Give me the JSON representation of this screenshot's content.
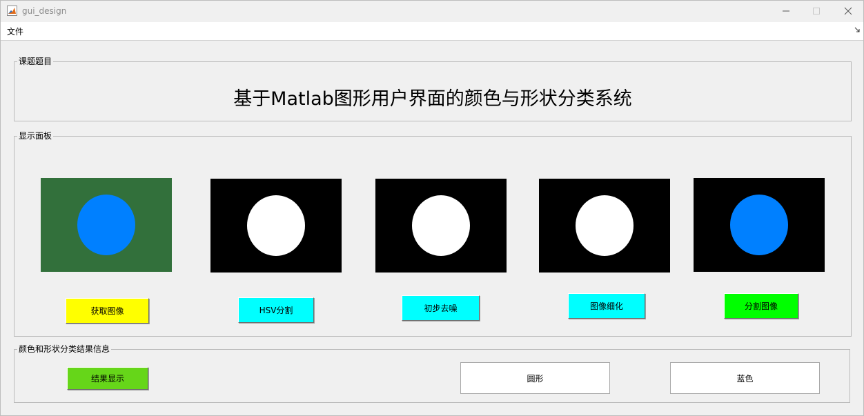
{
  "window": {
    "title": "gui_design"
  },
  "menu": {
    "file_label": "文件"
  },
  "title_panel": {
    "legend": "课题题目",
    "heading": "基于Matlab图形用户界面的颜色与形状分类系统"
  },
  "display_panel": {
    "legend": "显示面板",
    "images": [
      {
        "name": "original-image",
        "background": "#32703b",
        "circle": "#0080ff"
      },
      {
        "name": "hsv-mask-image",
        "background": "#000000",
        "circle": "#ffffff"
      },
      {
        "name": "denoised-image",
        "background": "#000000",
        "circle": "#ffffff"
      },
      {
        "name": "thinned-image",
        "background": "#000000",
        "circle": "#ffffff"
      },
      {
        "name": "segmented-image",
        "background": "#000000",
        "circle": "#0080ff"
      }
    ],
    "buttons": [
      {
        "label": "获取图像",
        "color": "#ffff00"
      },
      {
        "label": "HSV分割",
        "color": "#00ffff"
      },
      {
        "label": "初步去噪",
        "color": "#00ffff"
      },
      {
        "label": "图像细化",
        "color": "#00ffff"
      },
      {
        "label": "分割图像",
        "color": "#00ff00"
      }
    ]
  },
  "result_panel": {
    "legend": "颜色和形状分类结果信息",
    "show_button": {
      "label": "结果显示",
      "color": "#66d619"
    },
    "shape_result": "圆形",
    "color_result": "蓝色"
  }
}
